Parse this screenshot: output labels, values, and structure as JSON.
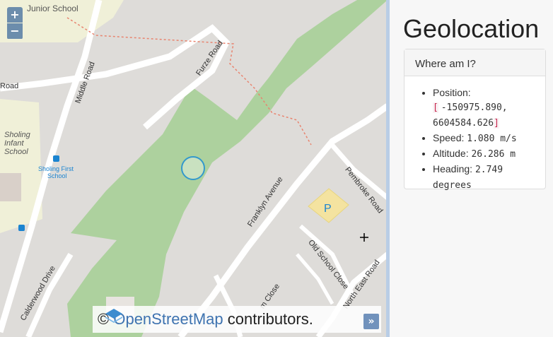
{
  "map": {
    "zoom_in_label": "+",
    "zoom_out_label": "−",
    "attribution": {
      "prefix": "©",
      "link_text": "OpenStreetMap",
      "suffix": "contributors.",
      "collapse_label": "»"
    },
    "labels": {
      "junior_school": "Junior School",
      "infant_school_1": "Sholing",
      "infant_school_2": "Infant",
      "infant_school_3": "School",
      "first_school_1": "Sholing First",
      "first_school_2": "School",
      "parking": "P"
    },
    "roads": {
      "road_partial": "Road",
      "middle_road": "Middle Road",
      "furze_road": "Furze Road",
      "franklyn_avenue": "Franklyn Avenue",
      "pembroke_road": "Pembroke Road",
      "old_school_close": "Old School Close",
      "north_east_road": "North East Road",
      "calderwood_drive": "Calderwood Drive",
      "pinewood_close": "m Close"
    }
  },
  "panel": {
    "title": "Geolocation",
    "card_title": "Where am I?",
    "position_label": "Position:",
    "position_bracket_open": "[",
    "position_x": "-150975.890,",
    "position_y": "6604584.626",
    "position_bracket_close": "]",
    "speed_label": "Speed:",
    "speed_value": "1.080 m/s",
    "altitude_label": "Altitude:",
    "altitude_value": "26.286 m",
    "heading_label": "Heading:",
    "heading_value": "2.749",
    "heading_unit": "degrees"
  },
  "colors": {
    "park": "#add19e",
    "road": "#ffffff",
    "map_bg": "#dedcd9",
    "school_area": "#f0f0d8",
    "location_marker": "#3399cc"
  }
}
